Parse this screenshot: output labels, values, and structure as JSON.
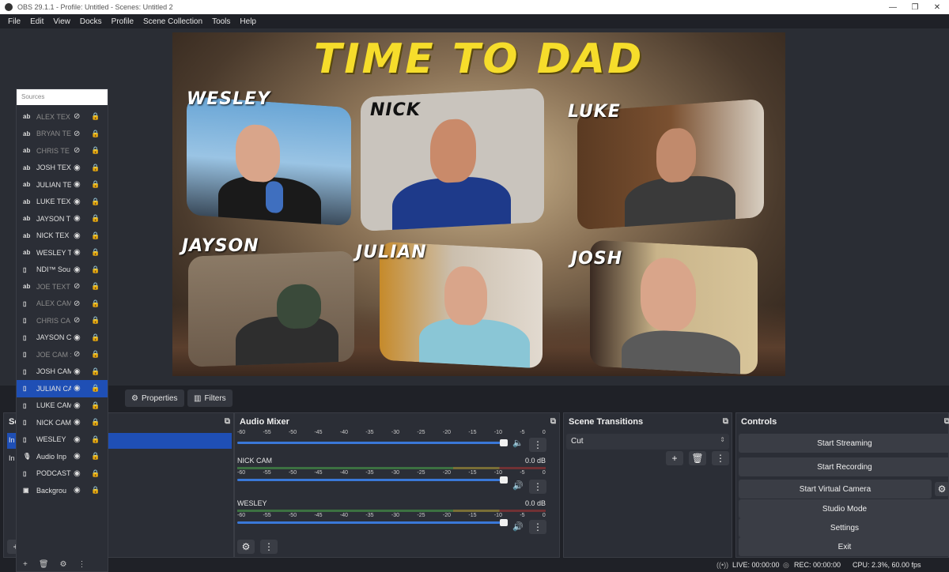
{
  "window": {
    "title": "OBS 29.1.1 - Profile: Untitled - Scenes: Untitled 2"
  },
  "menu": [
    "File",
    "Edit",
    "View",
    "Docks",
    "Profile",
    "Scene Collection",
    "Tools",
    "Help"
  ],
  "preview": {
    "headline": "TIME TO DAD",
    "cams": [
      {
        "name": "WESLEY"
      },
      {
        "name": "NICK"
      },
      {
        "name": "LUKE"
      },
      {
        "name": "JAYSON"
      },
      {
        "name": "JULIAN"
      },
      {
        "name": "JOSH"
      }
    ]
  },
  "sources": {
    "placeholder": "Sources",
    "items": [
      {
        "label": "ALEX TEX",
        "icon": "ab",
        "dim": true,
        "visible": false
      },
      {
        "label": "BRYAN TE",
        "icon": "ab",
        "dim": true,
        "visible": false
      },
      {
        "label": "CHRIS TE",
        "icon": "ab",
        "dim": true,
        "visible": false
      },
      {
        "label": "JOSH TEXT",
        "icon": "ab",
        "dim": false,
        "visible": true
      },
      {
        "label": "JULIAN TE",
        "icon": "ab",
        "dim": false,
        "visible": true
      },
      {
        "label": "LUKE TEX",
        "icon": "ab",
        "dim": false,
        "visible": true
      },
      {
        "label": "JAYSON T",
        "icon": "ab",
        "dim": false,
        "visible": true
      },
      {
        "label": "NICK TEX",
        "icon": "ab",
        "dim": false,
        "visible": true
      },
      {
        "label": "WESLEY T",
        "icon": "ab",
        "dim": false,
        "visible": true
      },
      {
        "label": "NDI™ Sou",
        "icon": "file",
        "dim": false,
        "visible": true
      },
      {
        "label": "JOE TEXT",
        "icon": "ab",
        "dim": true,
        "visible": false
      },
      {
        "label": "ALEX CAM",
        "icon": "file",
        "dim": true,
        "visible": false
      },
      {
        "label": "CHRIS CA",
        "icon": "file",
        "dim": true,
        "visible": false
      },
      {
        "label": "JAYSON C",
        "icon": "file",
        "dim": false,
        "visible": true
      },
      {
        "label": "JOE CAM :",
        "icon": "file",
        "dim": true,
        "visible": false
      },
      {
        "label": "JOSH CAM",
        "icon": "file",
        "dim": false,
        "visible": true
      },
      {
        "label": "JULIAN CA",
        "icon": "file",
        "dim": false,
        "visible": true,
        "selected": true
      },
      {
        "label": "LUKE CAM",
        "icon": "file",
        "dim": false,
        "visible": true
      },
      {
        "label": "NICK CAM",
        "icon": "file",
        "dim": false,
        "visible": true
      },
      {
        "label": "WESLEY",
        "icon": "file",
        "dim": false,
        "visible": true
      },
      {
        "label": "Audio Inp",
        "icon": "mic",
        "dim": false,
        "visible": true
      },
      {
        "label": "PODCAST",
        "icon": "file",
        "dim": false,
        "visible": true
      },
      {
        "label": "Backgrou",
        "icon": "image",
        "dim": false,
        "visible": true
      }
    ]
  },
  "toolbar": {
    "properties": "Properties",
    "filters": "Filters"
  },
  "scenes_dock": {
    "title_fragment": "Sc",
    "items": [
      "In",
      "In"
    ]
  },
  "mixer": {
    "title": "Audio Mixer",
    "scale": [
      "-60",
      "-55",
      "-50",
      "-45",
      "-40",
      "-35",
      "-30",
      "-25",
      "-20",
      "-15",
      "-10",
      "-5",
      "0"
    ],
    "tracks": [
      {
        "name": "",
        "db": ""
      },
      {
        "name": "NICK CAM",
        "db": "0.0 dB"
      },
      {
        "name": "WESLEY",
        "db": "0.0 dB"
      }
    ]
  },
  "transitions": {
    "title": "Scene Transitions",
    "selected": "Cut"
  },
  "controls": {
    "title": "Controls",
    "buttons": [
      "Start Streaming",
      "Start Recording",
      "Start Virtual Camera",
      "Studio Mode",
      "Settings",
      "Exit"
    ]
  },
  "status": {
    "live": "LIVE: 00:00:00",
    "rec": "REC: 00:00:00",
    "cpu": "CPU: 2.3%, 60.00 fps"
  }
}
